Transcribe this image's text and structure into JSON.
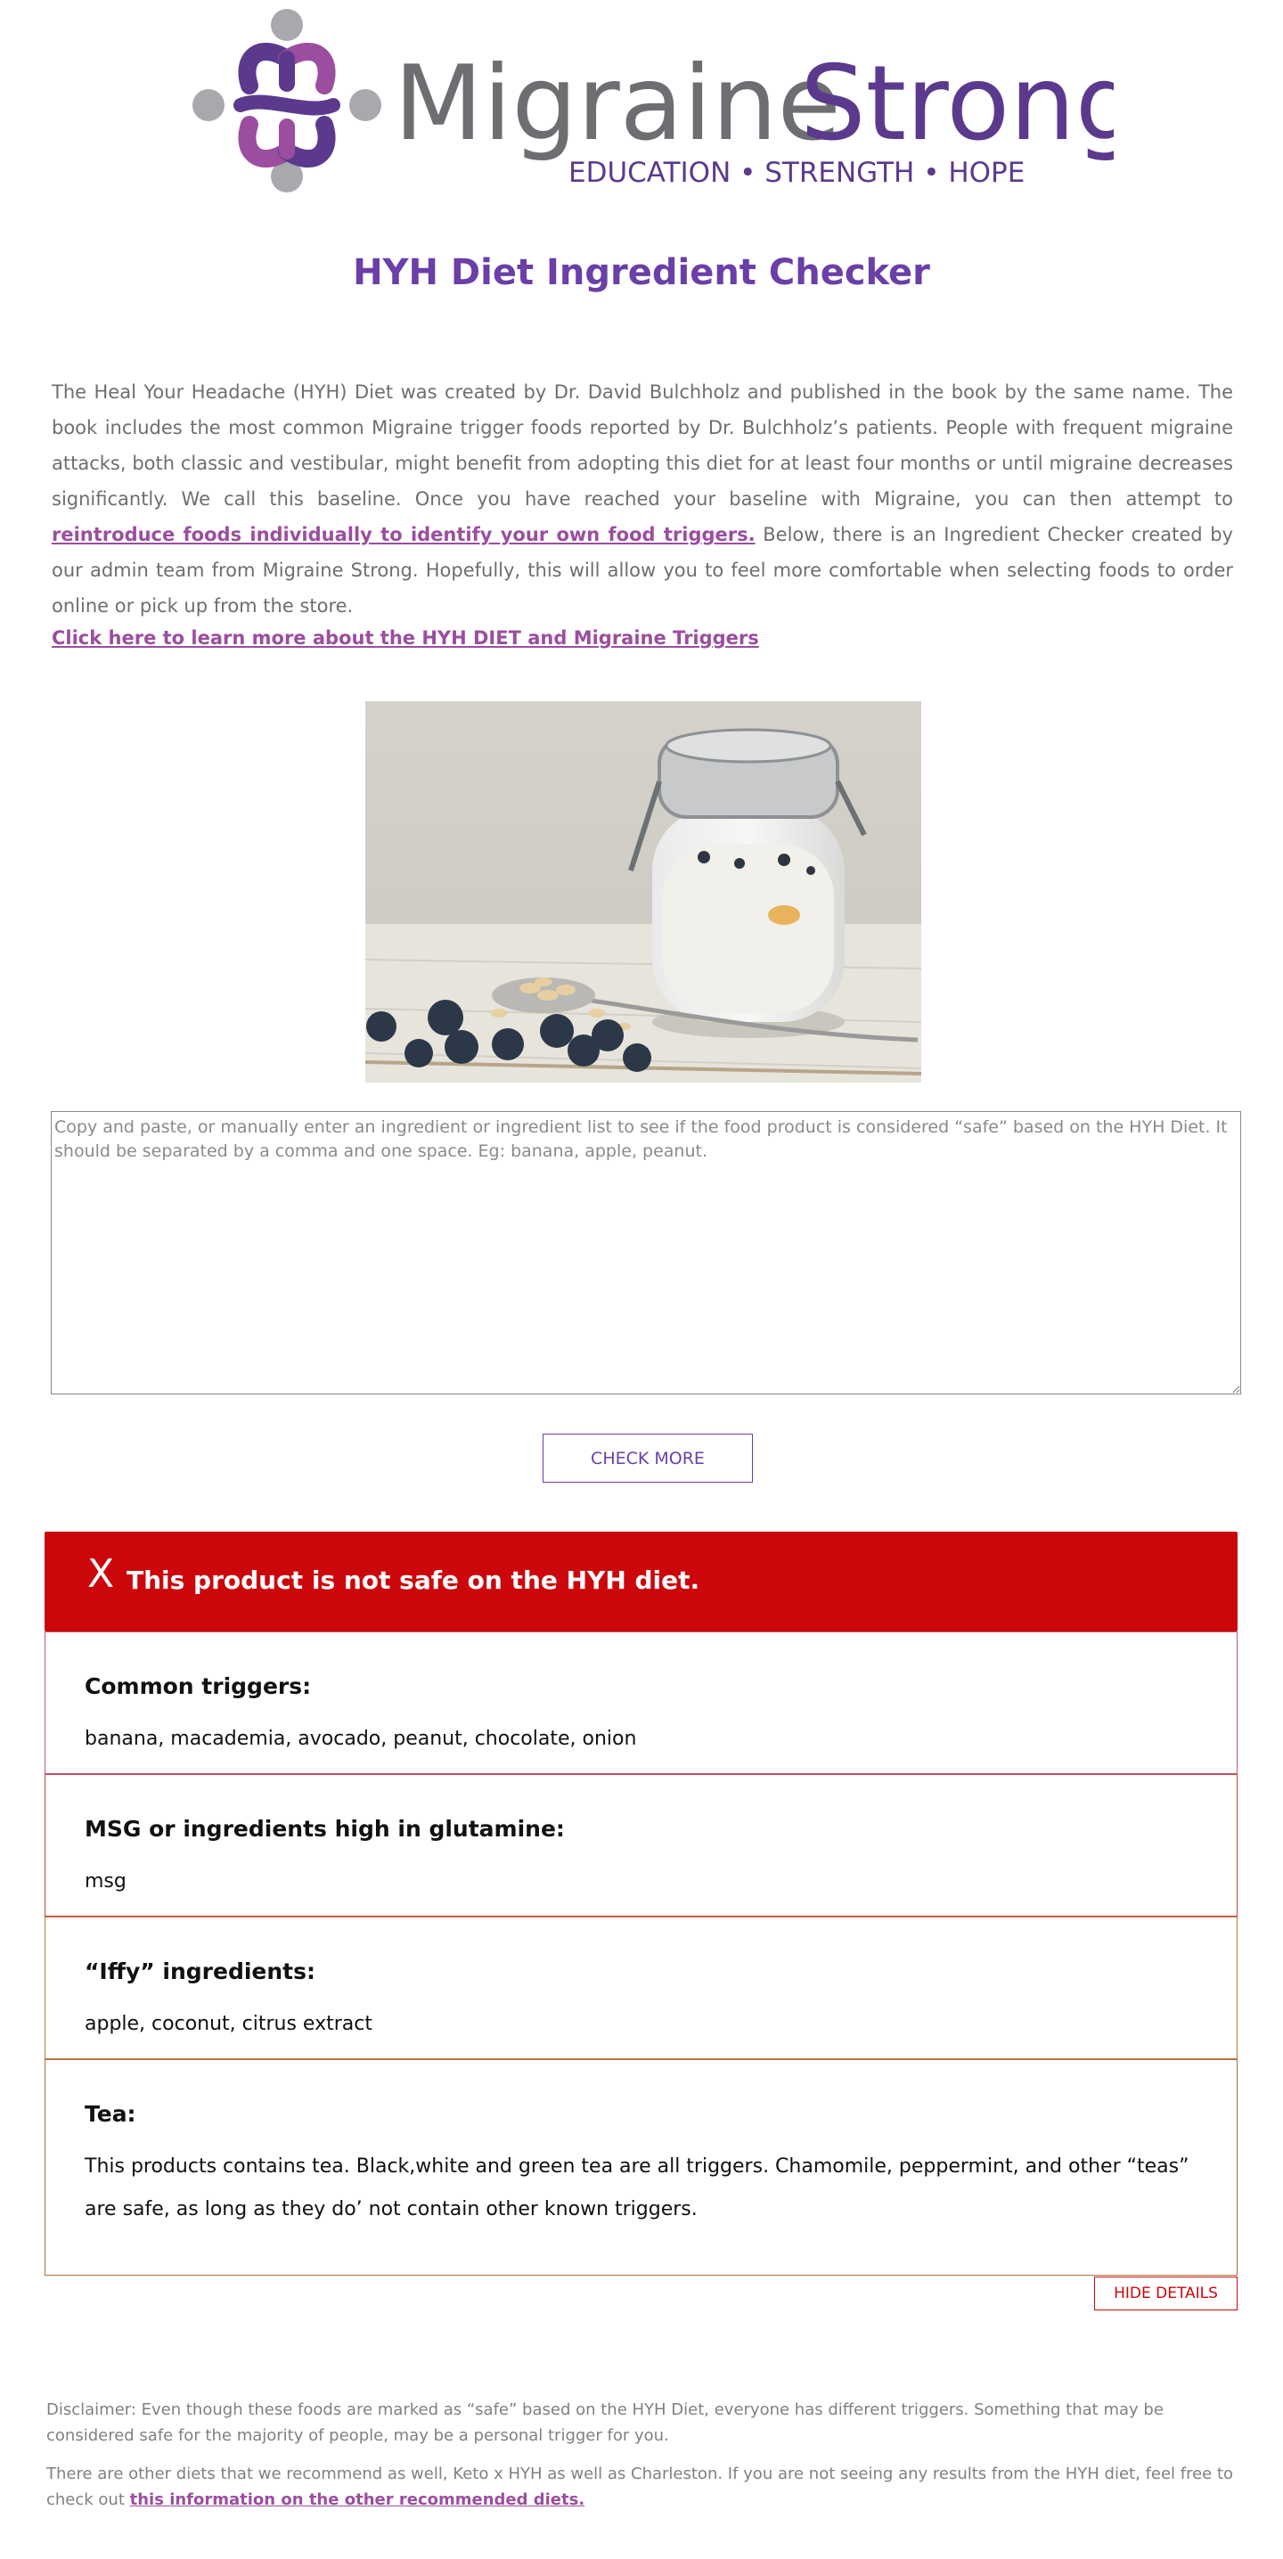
{
  "logo": {
    "brand_word_1": "Migraine",
    "brand_word_2": "Strong",
    "tagline": "EDUCATION • STRENGTH • HOPE",
    "colors": {
      "purple": "#5b3a8e",
      "light_purple": "#9b4e9f",
      "gray": "#6d6e71",
      "dot_gray": "#a7a9ac"
    }
  },
  "page": {
    "title": "HYH Diet Ingredient Checker"
  },
  "intro": {
    "text_before_link": "The Heal Your Headache (HYH) Diet was created by Dr. David Bulchholz and published in the book by the same name. The book includes the most common Migraine trigger foods reported by Dr. Bulchholz’s patients. People with frequent migraine attacks, both classic and vestibular, might benefit from adopting this diet for at least four months or until migraine decreases significantly. We call this baseline. Once you have reached your baseline with Migraine, you can then attempt to ",
    "link_text": "reintroduce foods individually to identify your own food triggers.",
    "text_after_link": " Below, there is an Ingredient Checker created by our admin team from Migraine Strong. Hopefully, this will allow you to feel more comfortable when selecting foods to order online or pick up from the store."
  },
  "learn_more": {
    "link_text": "Click here to learn more about the HYH DIET and Migraine Triggers"
  },
  "checker": {
    "value": "",
    "placeholder": "Copy and paste, or manually enter an ingredient or ingredient list to see if the food product is considered “safe” based on the HYH Diet. It should be separated by a comma and one space. Eg: banana, apple, peanut.",
    "button_label": "CHECK MORE"
  },
  "result": {
    "icon_text": "X",
    "message": "This product is not safe on the HYH diet.",
    "color": "#cc070b",
    "sections": [
      {
        "heading": "Common triggers:",
        "items": "banana, macademia, avocado, peanut, chocolate, onion"
      },
      {
        "heading": "MSG or ingredients high in glutamine:",
        "items": "msg"
      },
      {
        "heading": "“Iffy” ingredients:",
        "items": "apple, coconut, citrus extract"
      },
      {
        "heading": "Tea:",
        "items": "This products contains tea. Black,white and green tea are all triggers. Chamomile, peppermint, and other “teas” are safe, as long as they do’ not contain other known triggers."
      }
    ],
    "hide_details_label": "HIDE DETAILS"
  },
  "footer": {
    "disclaimer": "Disclaimer: Even though these foods are marked as “safe” based on the HYH Diet, everyone has different triggers. Something that may be considered safe for the majority of people, may be a personal trigger for you.",
    "other_diets_text": "There are other diets that we recommend as well, Keto x HYH as well as Charleston. If you are not seeing any results from the HYH diet, feel free to check out ",
    "other_diets_link": "this information on the other recommended diets."
  }
}
